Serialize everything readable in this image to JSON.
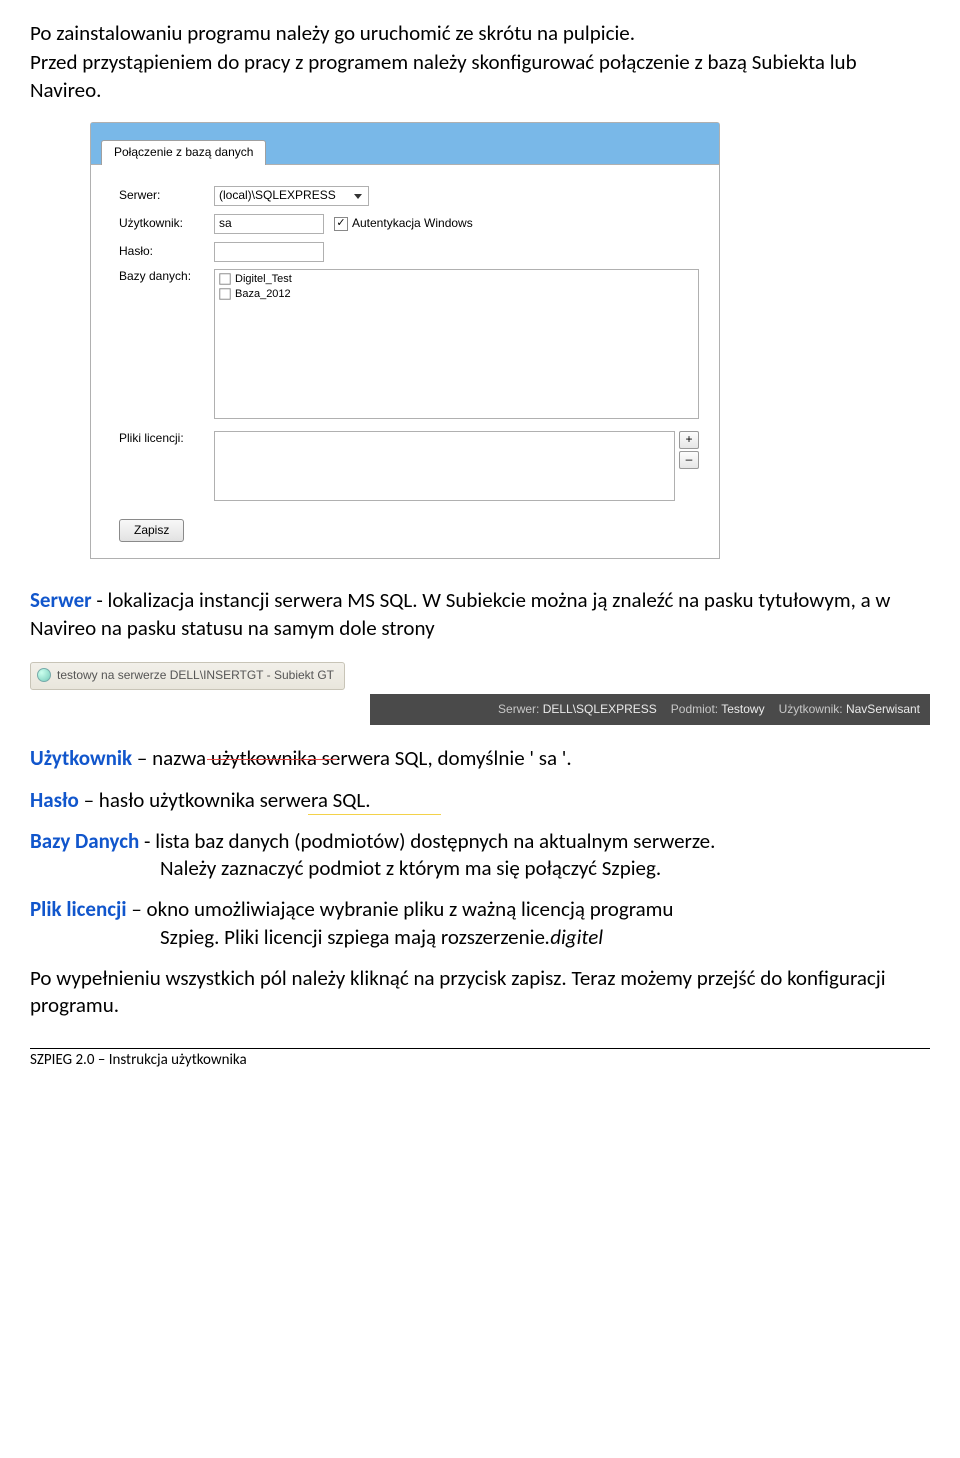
{
  "intro": {
    "line1": "Po zainstalowaniu programu należy go uruchomić ze skrótu na pulpicie.",
    "line2": "Przed przystąpieniem do pracy z programem należy skonfigurować połączenie z bazą Subiekta lub Navireo."
  },
  "window": {
    "tab_title": "Połączenie z bazą danych",
    "labels": {
      "server": "Serwer:",
      "user": "Użytkownik:",
      "pass": "Hasło:",
      "dbs": "Bazy danych:",
      "lic": "Pliki licencji:"
    },
    "server_value": "(local)\\SQLEXPRESS",
    "user_value": "sa",
    "auth_label": "Autentykacja Windows",
    "db_items": [
      "Digitel_Test",
      "Baza_2012"
    ],
    "plus": "+",
    "minus": "–",
    "save": "Zapisz"
  },
  "serwer_def": {
    "term": "Serwer",
    "text1": " - lokalizacja  instancji serwera MS SQL. W Subiekcie można ją znaleźć na pasku tytułowym, a w Navireo na pasku statusu na samym dole strony"
  },
  "snippet1_text": "testowy na serwerze DELL\\INSERTGT - Subiekt GT",
  "snippet2": {
    "s_lbl": "Serwer:",
    "s_val": "DELL\\SQLEXPRESS",
    "p_lbl": "Podmiot:",
    "p_val": "Testowy",
    "u_lbl": "Użytkownik:",
    "u_val": "NavSerwisant"
  },
  "user_def": {
    "term": "Użytkownik",
    "pre": " – nazwa ",
    "mid": "użytkownik",
    "post": "a serwera SQL, domyślnie ' sa '."
  },
  "pass_def": {
    "term": "Hasło",
    "pre": " – hasło użytkownika serwera ",
    "mid": "SQL."
  },
  "db_def": {
    "term": "Bazy Danych",
    "l1": " - lista baz danych (podmiotów) dostępnych na aktualnym serwerze.",
    "l2": "Należy zaznaczyć podmiot z którym ma się połączyć Szpieg."
  },
  "lic_def": {
    "term": "Plik licencji",
    "l1": " – okno umożliwiające wybranie pliku z ważną licencją programu",
    "l2": "Szpieg. Pliki licencji szpiega mają rozszerzenie",
    "ext": ".digitel"
  },
  "outro": "Po wypełnieniu wszystkich pól należy kliknąć na przycisk zapisz. Teraz możemy przejść do konfiguracji programu.",
  "footer": "SZPIEG 2.0 – Instrukcja użytkownika"
}
